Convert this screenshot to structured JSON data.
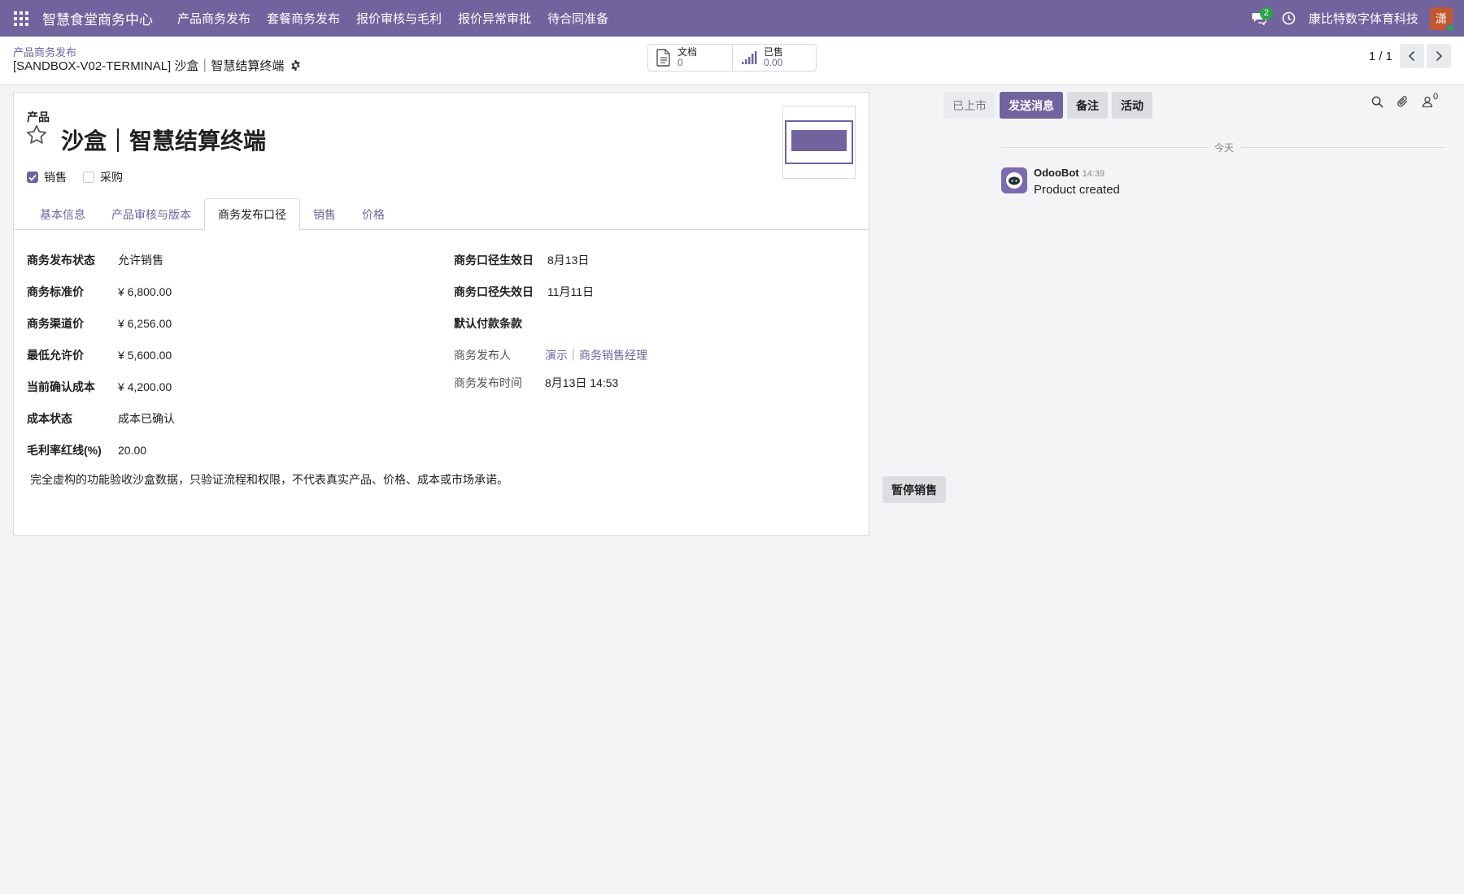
{
  "navbar": {
    "brand": "智慧食堂商务中心",
    "menu": [
      "产品商务发布",
      "套餐商务发布",
      "报价审核与毛利",
      "报价异常审批",
      "待合同准备"
    ],
    "chat_badge": "2",
    "company": "康比特数字体育科技",
    "avatar_initial": "潇"
  },
  "control": {
    "breadcrumb": "产品商务发布",
    "record_title": "[SANDBOX-V02-TERMINAL] 沙盒｜智慧结算终端",
    "stats": [
      {
        "label": "文档",
        "value": "0",
        "icon": "document-icon"
      },
      {
        "label": "已售",
        "value": "0.00",
        "icon": "bar-chart-icon"
      }
    ],
    "pager": "1 / 1"
  },
  "form": {
    "product_label": "产品",
    "product_name": "沙盒｜智慧结算终端",
    "checks": [
      {
        "label": "销售",
        "checked": true
      },
      {
        "label": "采购",
        "checked": false
      }
    ],
    "tabs": [
      "基本信息",
      "产品审核与版本",
      "商务发布口径",
      "销售",
      "价格"
    ],
    "active_tab": "商务发布口径",
    "left_fields": [
      {
        "label": "商务发布状态",
        "value": "允许销售"
      },
      {
        "label": "商务标准价",
        "value": "¥ 6,800.00"
      },
      {
        "label": "商务渠道价",
        "value": "¥ 6,256.00"
      },
      {
        "label": "最低允许价",
        "value": "¥ 5,600.00"
      },
      {
        "label": "当前确认成本",
        "value": "¥ 4,200.00"
      },
      {
        "label": "成本状态",
        "value": "成本已确认"
      },
      {
        "label": "毛利率红线(%)",
        "value": "20.00"
      }
    ],
    "right_fields": [
      {
        "label": "商务口径生效日",
        "value": "8月13日"
      },
      {
        "label": "商务口径失效日",
        "value": "11月11日"
      },
      {
        "label": "默认付款条款",
        "value": ""
      },
      {
        "label": "商务发布人",
        "value": "演示｜商务销售经理"
      },
      {
        "label": "商务发布时间",
        "value": "8月13日 14:53"
      }
    ],
    "note": "完全虚构的功能验收沙盒数据，只验证流程和权限，不代表真实产品、价格、成本或市场承诺。"
  },
  "actions": {
    "pause_sale": "暂停销售"
  },
  "chatter": {
    "status_button": "已上市",
    "send_message": "发送消息",
    "log_note": "备注",
    "activity": "活动",
    "followers_count": "0",
    "date_divider": "今天",
    "message": {
      "author": "OdooBot",
      "time": "14:39",
      "body": "Product created"
    }
  },
  "colors": {
    "brand": "#71639e",
    "badge": "#28a745"
  }
}
